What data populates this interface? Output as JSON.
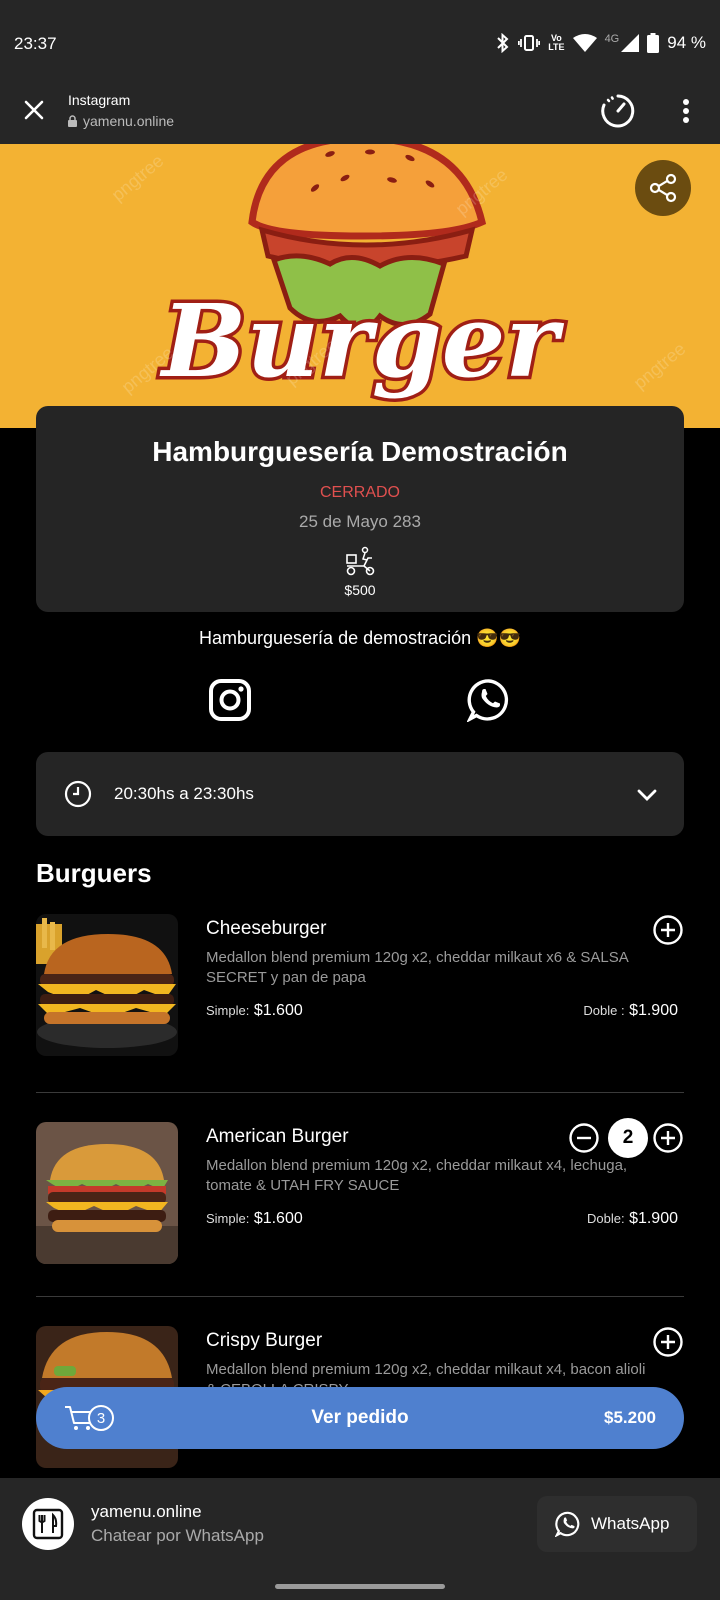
{
  "status_bar": {
    "time": "23:37",
    "network": "4G",
    "battery": "94 %"
  },
  "browser": {
    "title": "Instagram",
    "url": "yamenu.online"
  },
  "hero": {
    "logo_text": "Burger",
    "watermark": "pngtree"
  },
  "restaurant": {
    "name": "Hamburguesería Demostración",
    "status": "CERRADO",
    "address": "25 de Mayo 283",
    "delivery_price": "$500",
    "description": "Hamburguesería de demostración 😎😎"
  },
  "hours": {
    "text": "20:30hs a 23:30hs"
  },
  "section": {
    "title": "Burguers"
  },
  "products": [
    {
      "name": "Cheeseburger",
      "description": "Medallon blend premium 120g x2, cheddar milkaut x6 & SALSA SECRET y pan de papa",
      "simple_label": "Simple:",
      "simple_price": "$1.600",
      "double_label": "Doble :",
      "double_price": "$1.900"
    },
    {
      "name": "American Burger",
      "description": "Medallon blend premium 120g x2, cheddar milkaut x4, lechuga, tomate & UTAH FRY SAUCE",
      "simple_label": "Simple:",
      "simple_price": "$1.600",
      "double_label": "Doble:",
      "double_price": "$1.900",
      "quantity": "2"
    },
    {
      "name": "Crispy Burger",
      "description": "Medallon blend premium 120g x2, cheddar milkaut x4, bacon alioli & CEBOLLA CRISPY"
    }
  ],
  "order": {
    "count": "3",
    "label": "Ver pedido",
    "total": "$5.200"
  },
  "bottom_sheet": {
    "site": "yamenu.online",
    "subtitle": "Chatear por WhatsApp",
    "whatsapp_label": "WhatsApp"
  },
  "colors": {
    "accent": "#4f80cf",
    "closed": "#e0504f",
    "banner": "#f3b233",
    "card": "#252525"
  }
}
